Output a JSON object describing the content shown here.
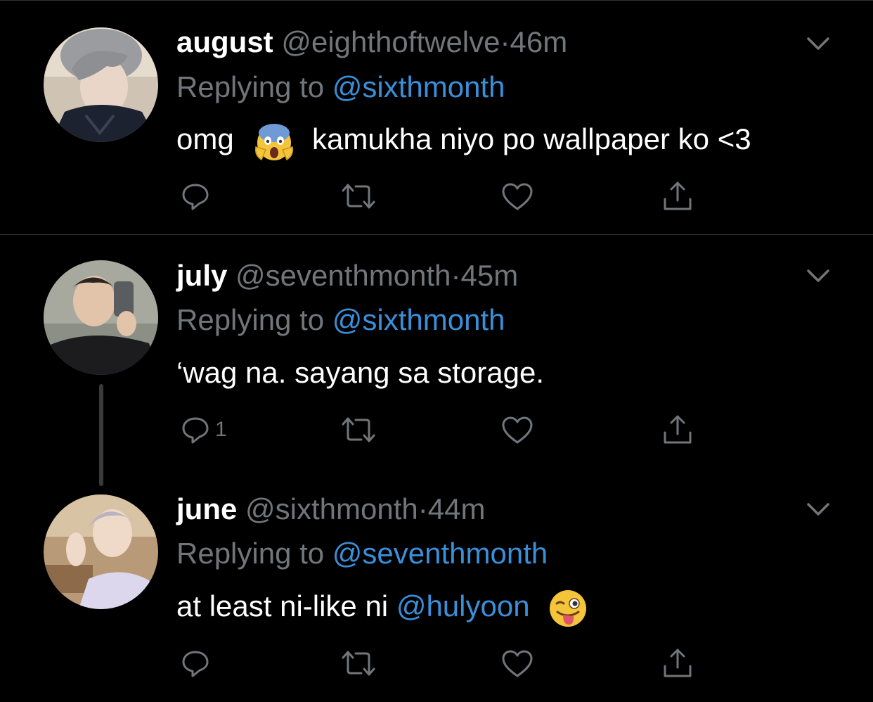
{
  "tweets": [
    {
      "name": "august",
      "handle": "@eighthoftwelve",
      "sep": "·",
      "time": "46m",
      "replying_prefix": "Replying to ",
      "replying_to": "@sixthmonth",
      "text_before": "omg",
      "text_after": "kamukha niyo po wallpaper ko <3",
      "emoji": "face-screaming-in-fear",
      "reply_count": ""
    },
    {
      "name": "july",
      "handle": "@seventhmonth",
      "sep": "·",
      "time": "45m",
      "replying_prefix": "Replying to ",
      "replying_to": "@sixthmonth",
      "text": "‘wag na. sayang sa storage.",
      "reply_count": "1"
    },
    {
      "name": "june",
      "handle": "@sixthmonth",
      "sep": "·",
      "time": "44m",
      "replying_prefix": "Replying to ",
      "replying_to": "@seventhmonth",
      "text_before": "at least ni-like ni ",
      "mention": "@hulyoon",
      "emoji": "winking-face-with-tongue",
      "reply_count": ""
    }
  ],
  "icons": [
    "chevron-down-icon",
    "reply-icon",
    "retweet-icon",
    "like-icon",
    "share-icon"
  ],
  "colors": {
    "background": "#000000",
    "link": "#3a8fd9",
    "muted": "#71767b",
    "text": "#ffffff"
  }
}
